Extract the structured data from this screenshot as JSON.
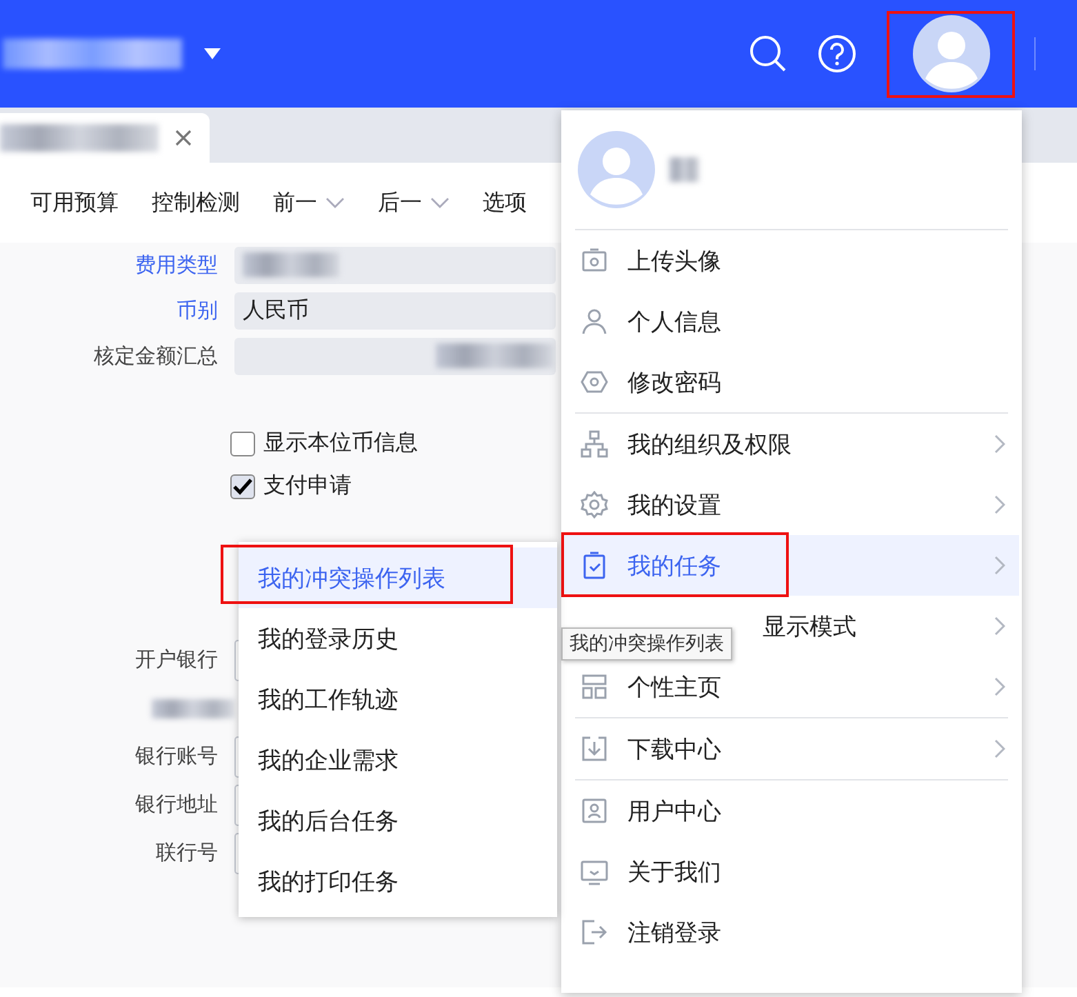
{
  "header": {
    "avatar_highlighted": true
  },
  "toolbar": [
    "可用预算",
    "控制检测",
    {
      "label": "前一",
      "dropdown": true
    },
    {
      "label": "后一",
      "dropdown": true
    },
    "选项"
  ],
  "form": {
    "rows": [
      {
        "label": "费用类型",
        "required": true
      },
      {
        "label": "币别",
        "required": true,
        "value": "人民币"
      },
      {
        "label": "核定金额汇总",
        "required": false
      }
    ],
    "checkboxes": [
      {
        "label": "显示本位币信息",
        "checked": false
      },
      {
        "label": "支付申请",
        "checked": true
      }
    ],
    "bank_rows": [
      "开户银行",
      "银行账号",
      "银行地址",
      "联行号"
    ]
  },
  "user_menu": {
    "groups": [
      [
        {
          "label": "上传头像",
          "has_submenu": false,
          "selected": false
        },
        {
          "label": "个人信息",
          "has_submenu": false,
          "selected": false
        },
        {
          "label": "修改密码",
          "has_submenu": false,
          "selected": false
        }
      ],
      [
        {
          "label": "我的组织及权限",
          "has_submenu": true,
          "selected": false
        },
        {
          "label": "我的设置",
          "has_submenu": true,
          "selected": false
        },
        {
          "label": "我的任务",
          "has_submenu": true,
          "selected": true,
          "highlighted": true
        },
        {
          "label": "显示模式",
          "has_submenu": true,
          "selected": false,
          "obscured": true
        },
        {
          "label": "个性主页",
          "has_submenu": true,
          "selected": false
        }
      ],
      [
        {
          "label": "下载中心",
          "has_submenu": true,
          "selected": false
        }
      ],
      [
        {
          "label": "用户中心",
          "has_submenu": false,
          "selected": false
        },
        {
          "label": "关于我们",
          "has_submenu": false,
          "selected": false
        },
        {
          "label": "注销登录",
          "has_submenu": false,
          "selected": false
        }
      ]
    ]
  },
  "submenu": [
    {
      "label": "我的冲突操作列表",
      "selected": true,
      "highlighted": true
    },
    {
      "label": "我的登录历史",
      "selected": false
    },
    {
      "label": "我的工作轨迹",
      "selected": false
    },
    {
      "label": "我的企业需求",
      "selected": false
    },
    {
      "label": "我的后台任务",
      "selected": false
    },
    {
      "label": "我的打印任务",
      "selected": false
    }
  ],
  "tooltip": "我的冲突操作列表"
}
